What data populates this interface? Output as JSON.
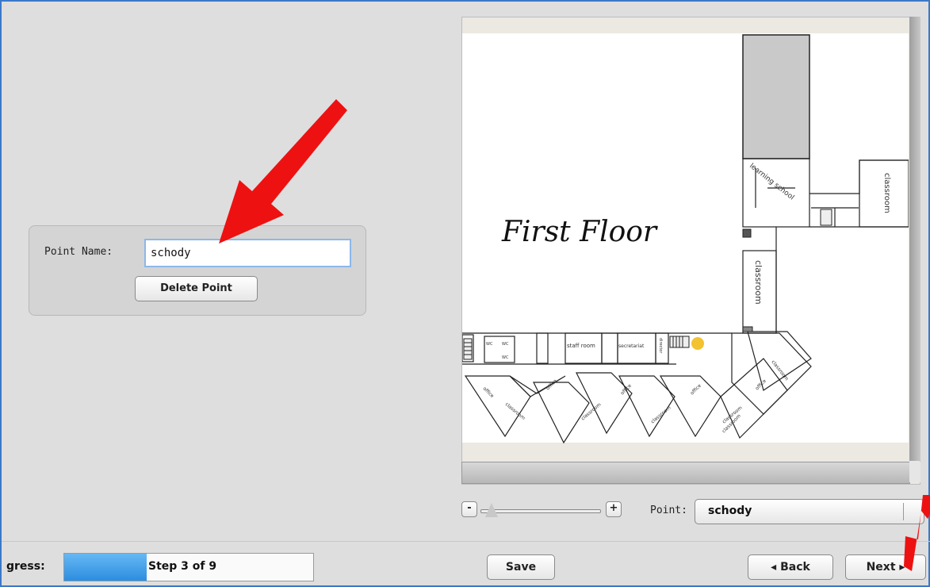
{
  "form": {
    "point_name_label": "Point Name:",
    "point_name_value": "schody",
    "delete_button": "Delete Point"
  },
  "map": {
    "floor_title": "First Floor",
    "labels": {
      "classroom_right": "classroom",
      "classroom_middle": "classroom",
      "learning_school": "learning school",
      "staff_room": "staff room",
      "secretariat": "secretariat",
      "director": "director",
      "wc1": "WC",
      "wc2": "WC",
      "wc3": "WC",
      "office1": "office",
      "office2": "office",
      "office3": "office",
      "office4": "office",
      "office5": "office",
      "classroom_b1": "classroom",
      "classroom_b2": "classroom",
      "classroom_b3": "classroom",
      "classroom_b4": "classroom",
      "classroom_b5": "classroom",
      "classroom_b6": "classroom"
    },
    "zoom_minus": "-",
    "zoom_plus": "+",
    "zoom_level": 0.05,
    "point_label": "Point:",
    "point_value": "schody"
  },
  "footer": {
    "progress_label": "gress:",
    "progress_text": "Step 3 of 9",
    "progress_fraction": 0.33,
    "save_label": "Save",
    "back_label": "◂  Back",
    "next_label": "Next  ▸"
  },
  "colors": {
    "frame_border": "#3c78c8",
    "progress_fill": "#4aa3ea",
    "arrow_red": "#ee1111",
    "marker_yellow": "#f2c230"
  }
}
